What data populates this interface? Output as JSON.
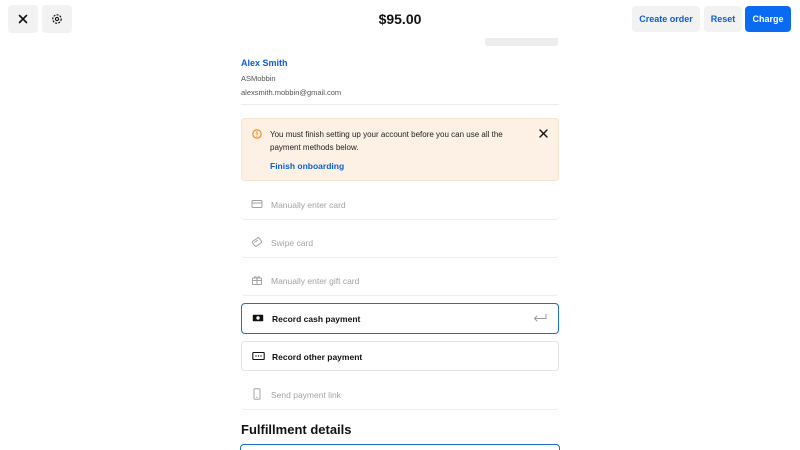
{
  "header": {
    "total": "$95.00",
    "create_order_label": "Create order",
    "reset_label": "Reset",
    "charge_label": "Charge"
  },
  "customer": {
    "name": "Alex Smith",
    "business": "ASMobbin",
    "email": "alexsmith.mobbin@gmail.com"
  },
  "alert": {
    "message": "You must finish setting up your account before you can use all the payment methods below.",
    "link_label": "Finish onboarding"
  },
  "payment_methods": [
    {
      "label": "Manually enter card",
      "icon": "card-icon",
      "state": "disabled"
    },
    {
      "label": "Swipe card",
      "icon": "swipe-card-icon",
      "state": "disabled"
    },
    {
      "label": "Manually enter gift card",
      "icon": "gift-card-icon",
      "state": "disabled"
    },
    {
      "label": "Record cash payment",
      "icon": "cash-icon",
      "state": "selected"
    },
    {
      "label": "Record other payment",
      "icon": "other-payment-icon",
      "state": "enabled"
    },
    {
      "label": "Send payment link",
      "icon": "phone-icon",
      "state": "disabled"
    }
  ],
  "fulfillment": {
    "title": "Fulfillment details"
  },
  "colors": {
    "accent": "#0b6bf0",
    "link": "#0b5fd6",
    "alert_bg": "#fdf1e5",
    "warning": "#e88a1a"
  }
}
